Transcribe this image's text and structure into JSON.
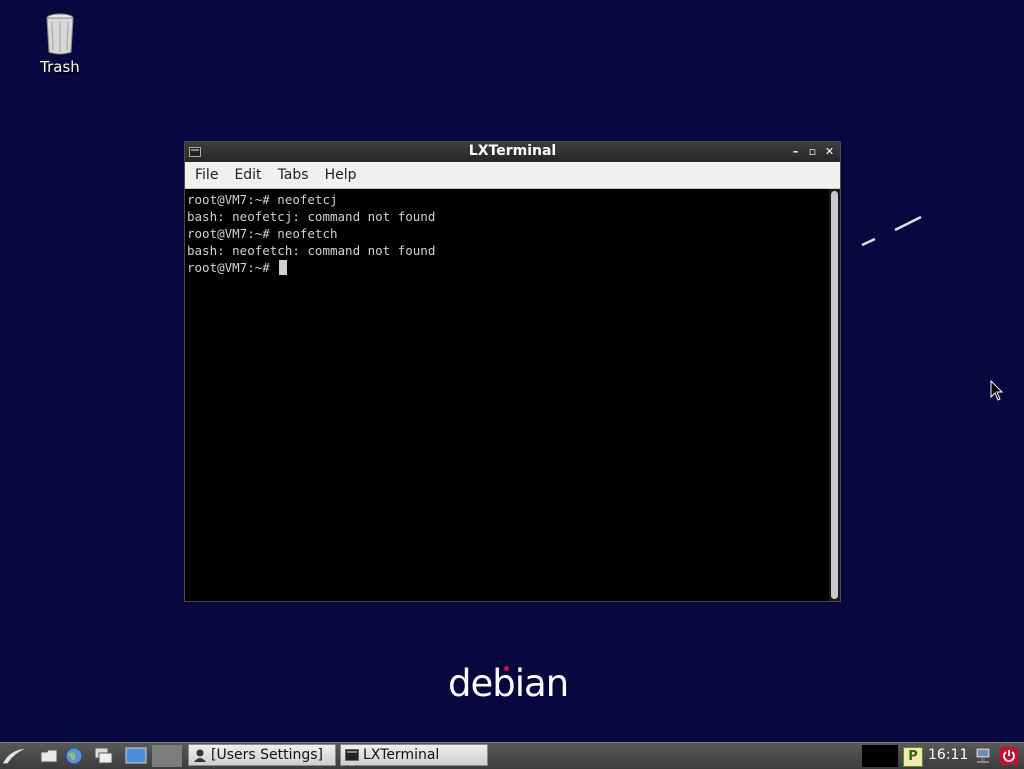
{
  "desktop": {
    "trash_label": "Trash",
    "background_color": "#06083f",
    "logo_text": "debian"
  },
  "terminal": {
    "title": "LXTerminal",
    "menu": [
      "File",
      "Edit",
      "Tabs",
      "Help"
    ],
    "lines": [
      "root@VM7:~# neofetcj",
      "bash: neofetcj: command not found",
      "root@VM7:~# neofetch",
      "bash: neofetch: command not found"
    ],
    "prompt": "root@VM7:~# "
  },
  "taskbar": {
    "tasks": [
      {
        "label": "[Users Settings]",
        "icon": "user-icon"
      },
      {
        "label": "LXTerminal",
        "icon": "terminal-icon"
      }
    ],
    "tray_p_label": "P",
    "clock": "16:11"
  }
}
